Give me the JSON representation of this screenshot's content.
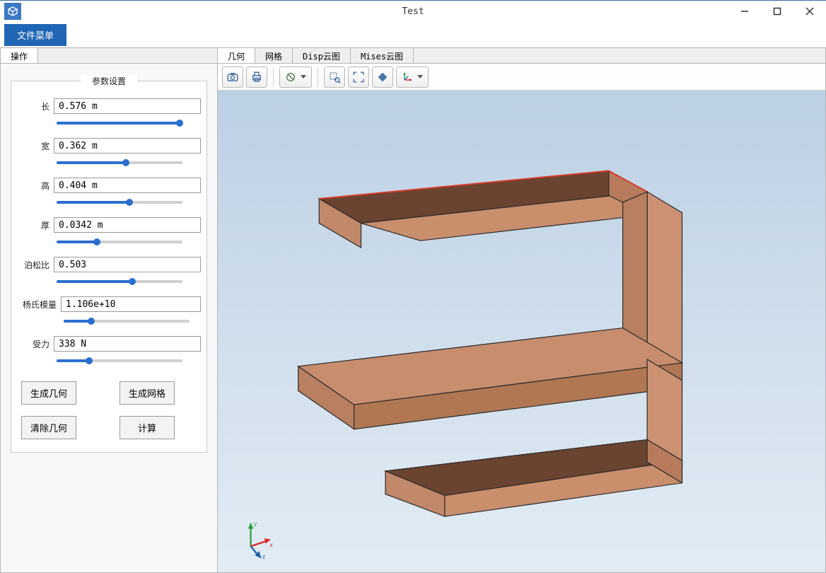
{
  "window": {
    "title": "Test"
  },
  "menu": {
    "file_menu": "文件菜单"
  },
  "left": {
    "tab": "操作",
    "legend": "参数设置",
    "params": [
      {
        "label": "长",
        "value": "0.576 m",
        "pct": 98
      },
      {
        "label": "宽",
        "value": "0.362 m",
        "pct": 55
      },
      {
        "label": "高",
        "value": "0.404 m",
        "pct": 58
      },
      {
        "label": "厚",
        "value": "0.0342 m",
        "pct": 32
      },
      {
        "label": "泊松比",
        "value": "0.503",
        "pct": 60
      },
      {
        "label": "杨氏模量",
        "value": "1.106e+10",
        "pct": 22
      },
      {
        "label": "受力",
        "value": "338 N",
        "pct": 26
      }
    ],
    "buttons": {
      "gen_geom": "生成几何",
      "gen_mesh": "生成网格",
      "clear_geom": "清除几何",
      "compute": "计算"
    }
  },
  "right": {
    "tabs": {
      "geometry": "几何",
      "mesh": "网格",
      "disp": "Disp云图",
      "mises": "Mises云图"
    }
  },
  "triad": {
    "x": "x",
    "y": "y",
    "z": "z"
  }
}
